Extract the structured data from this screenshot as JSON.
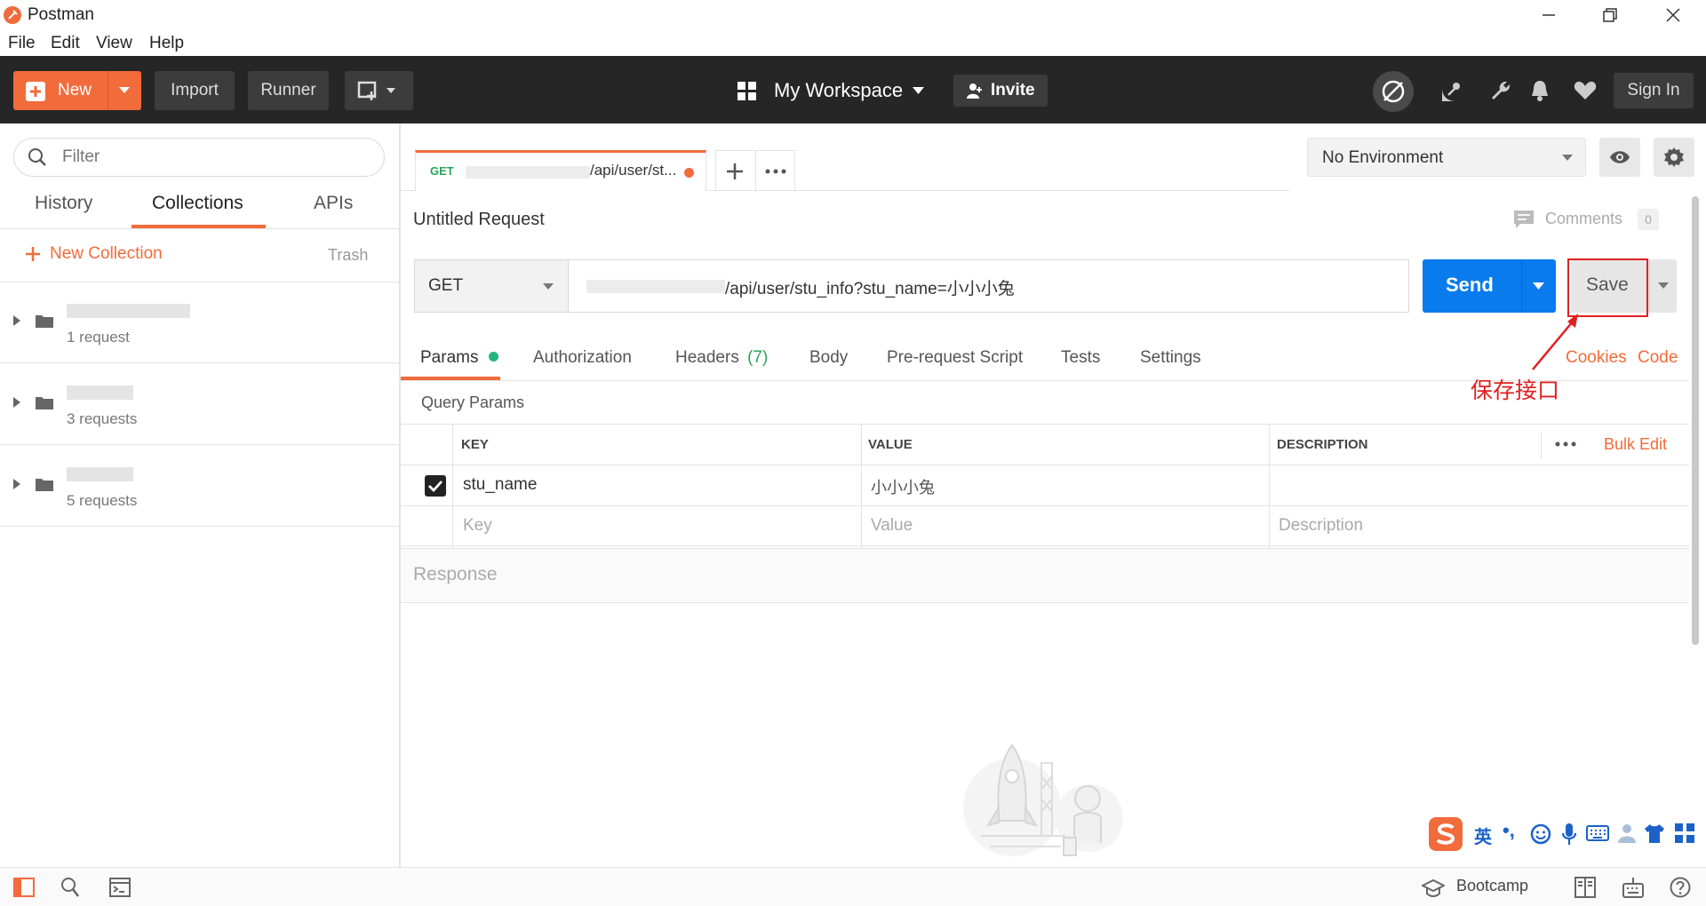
{
  "window": {
    "title": "Postman"
  },
  "menu": {
    "items": [
      "File",
      "Edit",
      "View",
      "Help"
    ]
  },
  "header": {
    "new_label": "New",
    "import_label": "Import",
    "runner_label": "Runner",
    "workspace_label": "My Workspace",
    "invite_label": "Invite",
    "signin_label": "Sign In"
  },
  "sidebar": {
    "filter_placeholder": "Filter",
    "tabs": [
      "History",
      "Collections",
      "APIs"
    ],
    "active_tab": "Collections",
    "new_collection_label": "New Collection",
    "trash_label": "Trash",
    "collections": [
      {
        "count": "1 request"
      },
      {
        "count": "3 requests"
      },
      {
        "count": "5 requests"
      }
    ]
  },
  "request_tab": {
    "method": "GET",
    "url_short": "/api/user/st..."
  },
  "environment": {
    "selected": "No Environment"
  },
  "request": {
    "name": "Untitled Request",
    "comments_label": "Comments",
    "comments_count": "0",
    "method": "GET",
    "url": "/api/user/stu_info?stu_name=小小小兔",
    "send_label": "Send",
    "save_label": "Save",
    "cookies_label": "Cookies",
    "code_label": "Code"
  },
  "request_tabs": [
    {
      "label": "Params"
    },
    {
      "label": "Authorization"
    },
    {
      "label": "Headers",
      "count": "(7)"
    },
    {
      "label": "Body"
    },
    {
      "label": "Pre-request Script"
    },
    {
      "label": "Tests"
    },
    {
      "label": "Settings"
    }
  ],
  "params": {
    "section_title": "Query Params",
    "columns": [
      "KEY",
      "VALUE",
      "DESCRIPTION"
    ],
    "bulk_edit_label": "Bulk Edit",
    "rows": [
      {
        "checked": true,
        "key": "stu_name",
        "value": "小小小兔",
        "description": ""
      }
    ],
    "placeholder_row": {
      "key": "Key",
      "value": "Value",
      "description": "Description"
    }
  },
  "response": {
    "title": "Response"
  },
  "statusbar": {
    "bootcamp_label": "Bootcamp"
  },
  "annotation": {
    "text": "保存接口"
  },
  "ime": {
    "mode_label": "英"
  },
  "colors": {
    "accent": "#f26b3a",
    "send": "#097bed",
    "header_bg": "#262626",
    "annotation": "#e02020",
    "param_dot": "#26b47f"
  }
}
